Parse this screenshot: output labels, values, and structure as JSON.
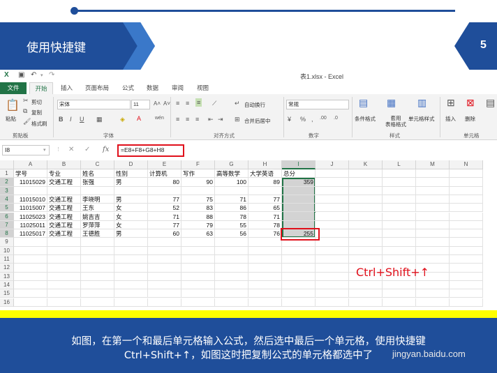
{
  "slide": {
    "title": "使用快捷键",
    "page_number": "5",
    "annotation": "Ctrl+Shift+↑",
    "caption_line1": "如图，在第一个和最后单元格输入公式，然后选中最后一个单元格，使用快捷键",
    "caption_line2": "Ctrl+Shift+↑，如图这时把复制公式的单元格都选中了",
    "watermark": "jingyan.baidu.com"
  },
  "colors": {
    "slide_blue": "#1f4e9a",
    "excel_green": "#217346",
    "highlight_red": "#e0101b",
    "caption_strip_yellow": "#ffff00"
  },
  "window": {
    "title": "表1.xlsx - Excel"
  },
  "tabs": [
    "文件",
    "开始",
    "插入",
    "页面布局",
    "公式",
    "数据",
    "审阅",
    "视图"
  ],
  "active_tab": "开始",
  "ribbon": {
    "clipboard": {
      "paste": "粘贴",
      "cut": "剪切",
      "copy": "复制",
      "format_painter": "格式刷",
      "label": "剪贴板"
    },
    "font": {
      "name": "宋体",
      "size": "11",
      "label": "字体"
    },
    "alignment": {
      "wrap": "自动换行",
      "merge": "合并后居中",
      "label": "对齐方式"
    },
    "number": {
      "format": "常规",
      "label": "数字"
    },
    "styles": {
      "conditional": "条件格式",
      "table": "套用\n表格格式",
      "cell_styles": "单元格样式",
      "label": "样式"
    },
    "cells": {
      "insert": "插入",
      "delete": "删除",
      "label": "单元格"
    }
  },
  "formula_bar": {
    "name_box": "I8",
    "formula": "=E8+F8+G8+H8"
  },
  "sheet": {
    "columns": [
      "A",
      "B",
      "C",
      "D",
      "E",
      "F",
      "G",
      "H",
      "I",
      "J",
      "K",
      "L",
      "M",
      "N"
    ],
    "row_numbers": [
      "1",
      "2",
      "3",
      "4",
      "5",
      "6",
      "7",
      "8",
      "9",
      "10",
      "11",
      "12",
      "13",
      "14",
      "15",
      "16"
    ],
    "header_row": [
      "学号",
      "专业",
      "姓名",
      "性别",
      "计算机",
      "写作",
      "高等数学",
      "大学英语",
      "总分"
    ],
    "rows": [
      [
        "11015029",
        "交通工程",
        "张强",
        "男",
        "80",
        "90",
        "100",
        "89",
        "359"
      ],
      [
        "",
        "",
        "",
        "",
        "",
        "",
        "",
        "",
        ""
      ],
      [
        "11015010",
        "交通工程",
        "李晓明",
        "男",
        "77",
        "75",
        "71",
        "77",
        ""
      ],
      [
        "11015007",
        "交通工程",
        "王东",
        "女",
        "52",
        "83",
        "86",
        "65",
        ""
      ],
      [
        "11025023",
        "交通工程",
        "姚吉吉",
        "女",
        "71",
        "88",
        "78",
        "71",
        ""
      ],
      [
        "11025011",
        "交通工程",
        "罗萍萍",
        "女",
        "77",
        "79",
        "55",
        "78",
        ""
      ],
      [
        "11025017",
        "交通工程",
        "王德胜",
        "男",
        "60",
        "63",
        "56",
        "76",
        "255"
      ]
    ],
    "selected_range": "I2:I8"
  }
}
